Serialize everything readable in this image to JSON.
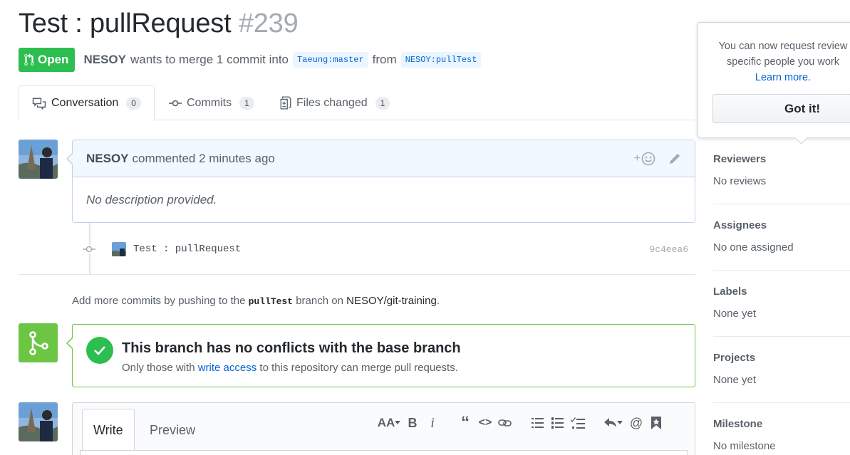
{
  "header": {
    "title": "Test : pullRequest",
    "number": "#239",
    "state_label": "Open",
    "author": "NESOY",
    "merge_text": "wants to merge 1 commit into",
    "base_branch": "Taeung:master",
    "from_text": "from",
    "head_branch": "NESOY:pullTest"
  },
  "tabs": [
    {
      "label": "Conversation",
      "count": "0",
      "icon": "comment-discussion-icon"
    },
    {
      "label": "Commits",
      "count": "1",
      "icon": "git-commit-icon"
    },
    {
      "label": "Files changed",
      "count": "1",
      "icon": "diff-icon"
    }
  ],
  "comment": {
    "author": "NESOY",
    "time_text": "commented 2 minutes ago",
    "body": "No description provided.",
    "reaction_label": "+"
  },
  "commit": {
    "message": "Test : pullRequest",
    "sha": "9c4eea6"
  },
  "hint": {
    "prefix": "Add more commits by pushing to the",
    "branch": "pullTest",
    "middle": "branch on",
    "repo": "NESOY/git-training",
    "suffix": "."
  },
  "merge": {
    "title": "This branch has no conflicts with the base branch",
    "sub_prefix": "Only those with",
    "sub_link": "write access",
    "sub_suffix": "to this repository can merge pull requests."
  },
  "editor": {
    "tab_write": "Write",
    "tab_preview": "Preview",
    "toolbar_text_size": "AA",
    "toolbar_bold": "B",
    "toolbar_italic": "i",
    "toolbar_mention": "@"
  },
  "sidebar": {
    "reviewers": {
      "label": "Reviewers",
      "value": "No reviews"
    },
    "assignees": {
      "label": "Assignees",
      "value": "No one assigned"
    },
    "labels": {
      "label": "Labels",
      "value": "None yet"
    },
    "projects": {
      "label": "Projects",
      "value": "None yet"
    },
    "milestone": {
      "label": "Milestone",
      "value": "No milestone"
    }
  },
  "popover": {
    "line1": "You can now request review",
    "line2": "specific people you work",
    "learn_more": "Learn more.",
    "button": "Got it!"
  },
  "colors": {
    "open_green": "#2cbe4e",
    "merge_green": "#6cc644",
    "link_blue": "#0366d6",
    "comment_header_bg": "#f1f8ff"
  }
}
